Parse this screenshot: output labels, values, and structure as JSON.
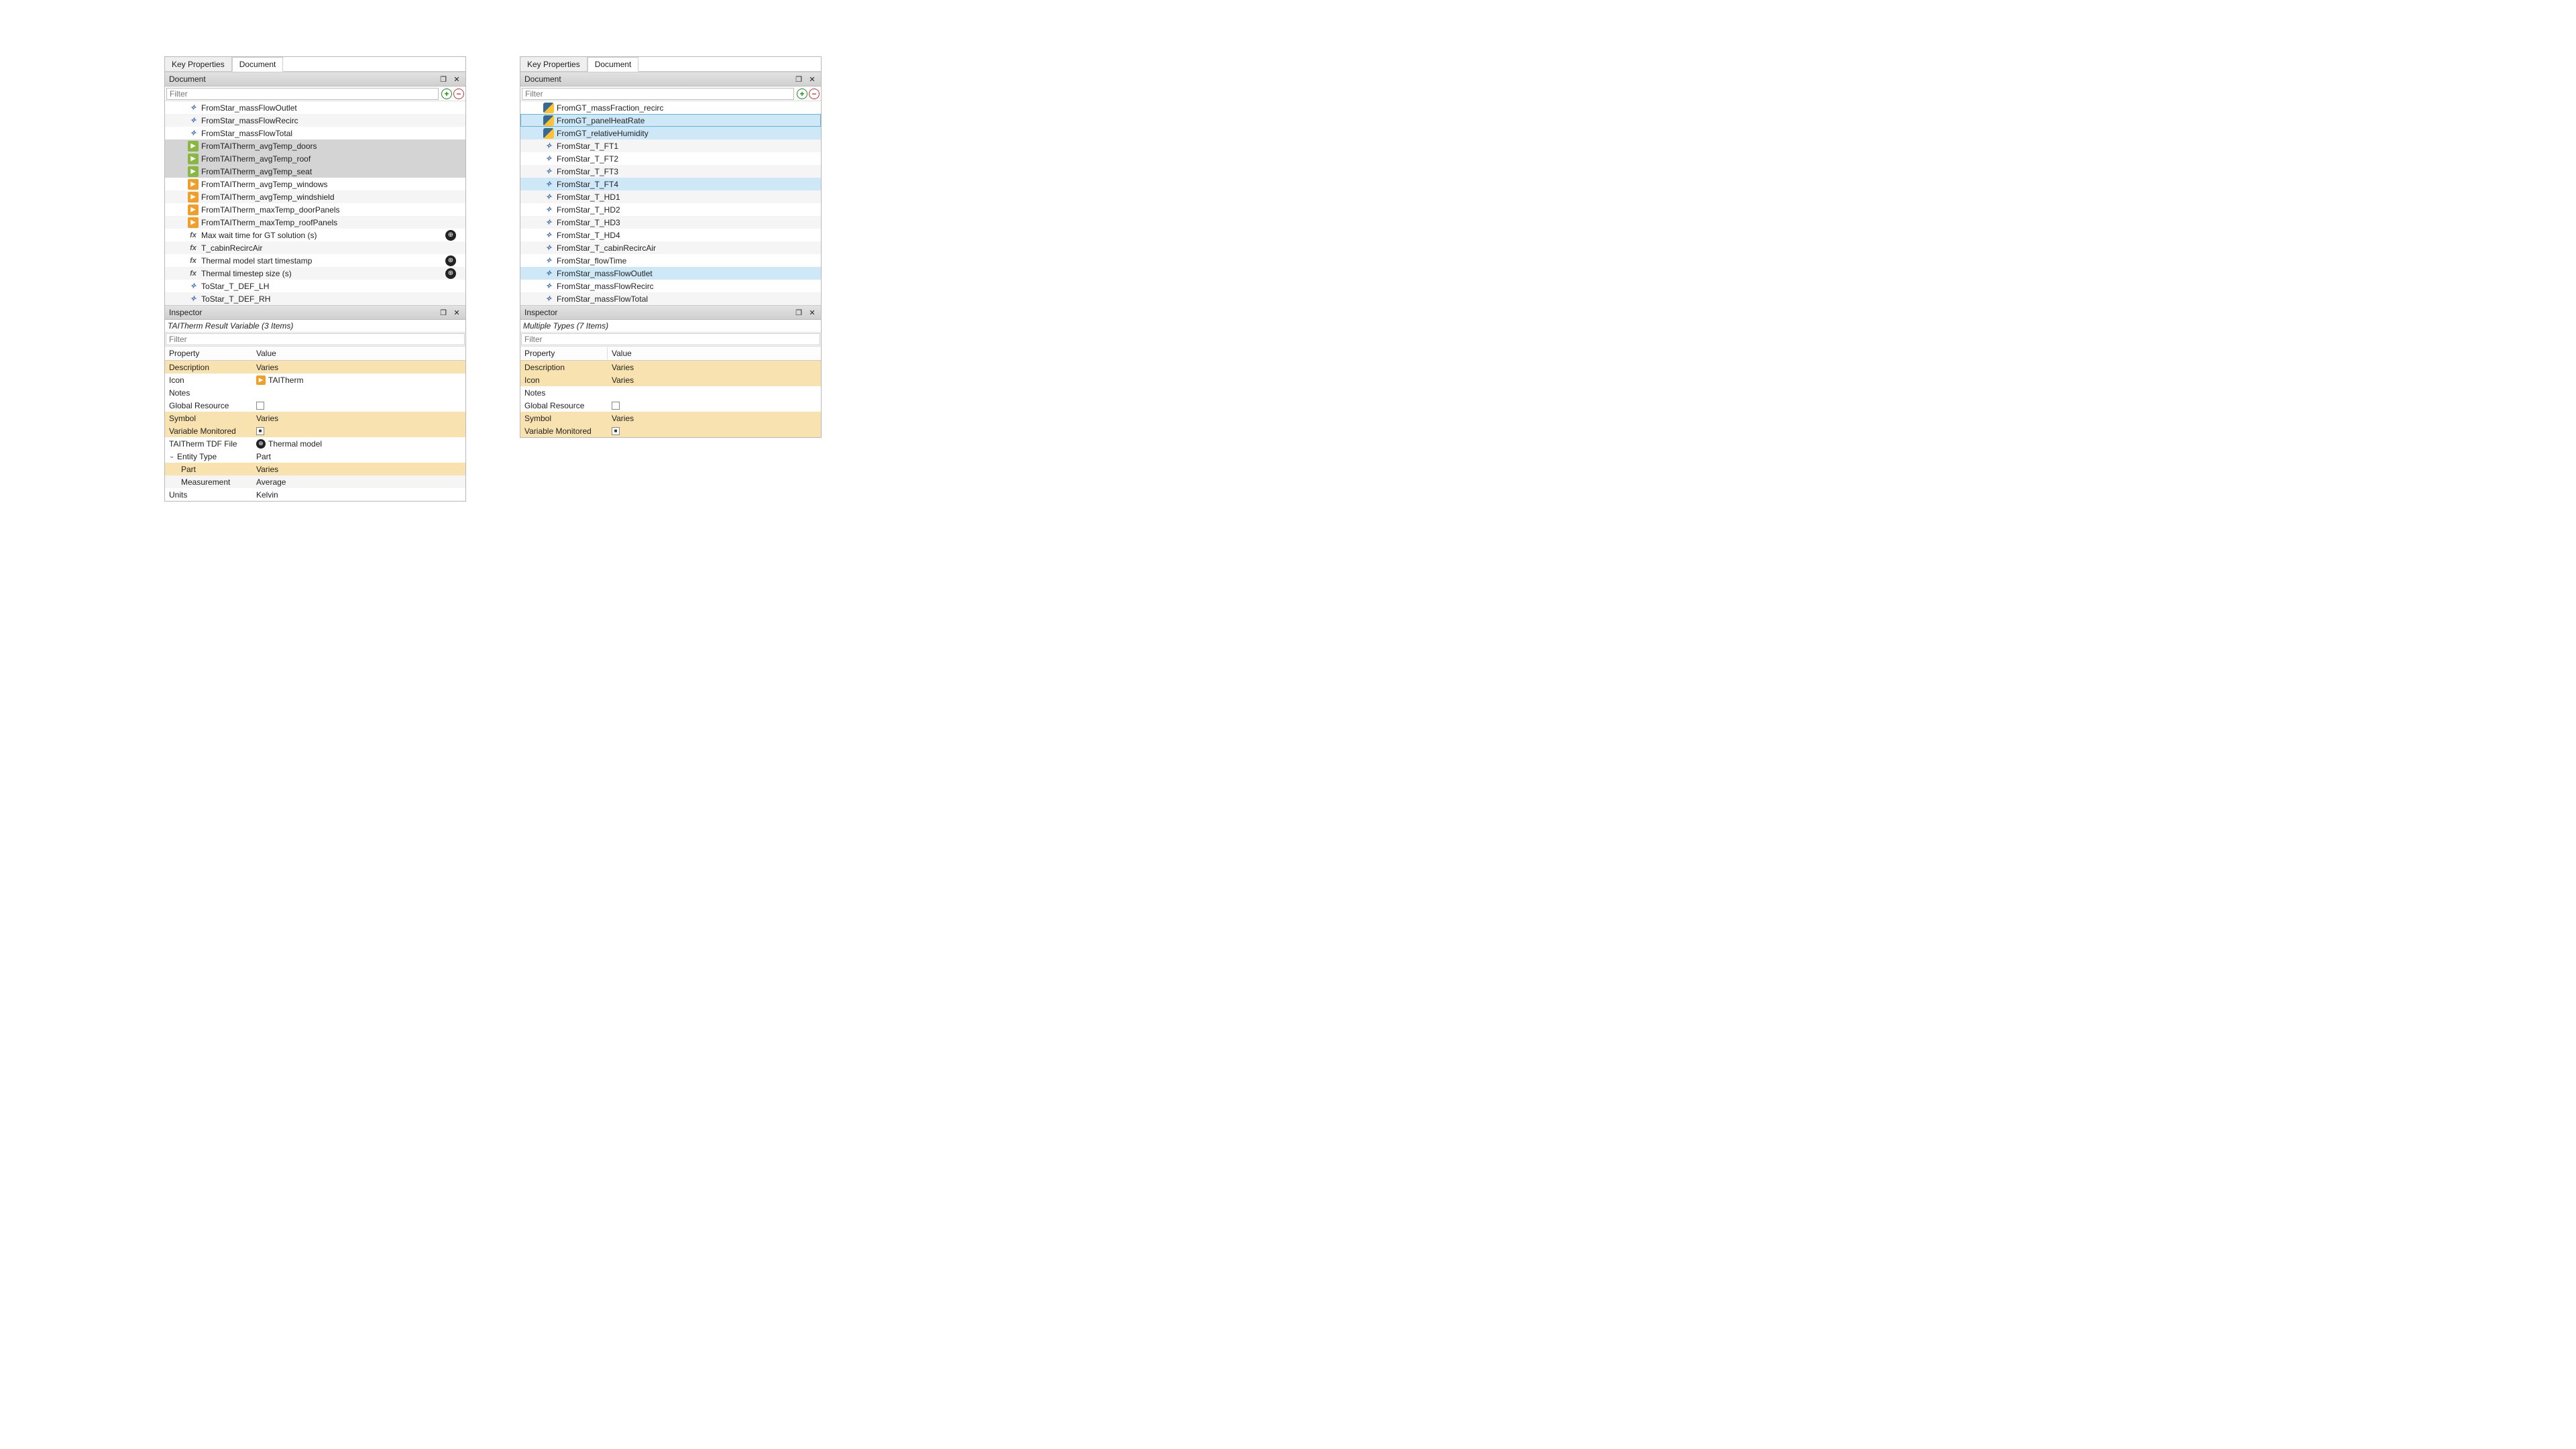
{
  "left": {
    "tabs": {
      "inactive": "Key Properties",
      "active": "Document"
    },
    "doc": {
      "title": "Document",
      "filter": "Filter",
      "items": [
        {
          "icon": "star",
          "label": "FromStar_massFlowOutlet"
        },
        {
          "icon": "star",
          "label": "FromStar_massFlowRecirc"
        },
        {
          "icon": "star",
          "label": "FromStar_massFlowTotal"
        },
        {
          "icon": "tai-g",
          "label": "FromTAITherm_avgTemp_doors",
          "sel": true
        },
        {
          "icon": "tai-g",
          "label": "FromTAITherm_avgTemp_roof",
          "sel": true
        },
        {
          "icon": "tai-g",
          "label": "FromTAITherm_avgTemp_seat",
          "sel": true
        },
        {
          "icon": "tai-y",
          "label": "FromTAITherm_avgTemp_windows"
        },
        {
          "icon": "tai-y",
          "label": "FromTAITherm_avgTemp_windshield"
        },
        {
          "icon": "tai-y",
          "label": "FromTAITherm_maxTemp_doorPanels"
        },
        {
          "icon": "tai-y",
          "label": "FromTAITherm_maxTemp_roofPanels"
        },
        {
          "icon": "fx",
          "label": "Max wait time for GT solution (s)",
          "globe": true
        },
        {
          "icon": "fx",
          "label": "T_cabinRecircAir"
        },
        {
          "icon": "fx",
          "label": "Thermal model start timestamp",
          "globe": true
        },
        {
          "icon": "fx",
          "label": "Thermal timestep size (s)",
          "globe": true
        },
        {
          "icon": "star",
          "label": "ToStar_T_DEF_LH"
        },
        {
          "icon": "star",
          "label": "ToStar_T_DEF_RH"
        }
      ]
    },
    "insp": {
      "title": "Inspector",
      "subtitle": "TAITherm Result Variable (3 Items)",
      "filter": "Filter",
      "hdr_property": "Property",
      "hdr_value": "Value",
      "rows": [
        {
          "k": "Description",
          "v": "Varies",
          "style": "y"
        },
        {
          "k": "Icon",
          "icon": "tai",
          "v": "TAITherm",
          "style": "w"
        },
        {
          "k": "Notes",
          "v": "",
          "style": "w"
        },
        {
          "k": "Global Resource",
          "chk": "empty",
          "style": "w"
        },
        {
          "k": "Symbol",
          "v": "Varies",
          "style": "y"
        },
        {
          "k": "Variable Monitored",
          "chk": "filled",
          "style": "y"
        },
        {
          "k": "TAITherm TDF File",
          "icon": "globe",
          "v": "Thermal model",
          "style": "w"
        },
        {
          "k": "Entity Type",
          "v": "Part",
          "style": "w",
          "expander": true
        },
        {
          "k": "Part",
          "v": "Varies",
          "style": "y",
          "indent": true
        },
        {
          "k": "Measurement",
          "v": "Average",
          "style": "g",
          "indent": true
        },
        {
          "k": "Units",
          "v": "Kelvin",
          "style": "w"
        }
      ]
    }
  },
  "right": {
    "tabs": {
      "inactive": "Key Properties",
      "active": "Document"
    },
    "doc": {
      "title": "Document",
      "filter": "Filter",
      "items": [
        {
          "icon": "py",
          "label": "FromGT_massFraction_recirc"
        },
        {
          "icon": "py",
          "label": "FromGT_panelHeatRate",
          "hi": true,
          "framed": true
        },
        {
          "icon": "py",
          "label": "FromGT_relativeHumidity",
          "hi": true
        },
        {
          "icon": "star",
          "label": "FromStar_T_FT1"
        },
        {
          "icon": "star",
          "label": "FromStar_T_FT2"
        },
        {
          "icon": "star",
          "label": "FromStar_T_FT3"
        },
        {
          "icon": "star",
          "label": "FromStar_T_FT4",
          "hi": true
        },
        {
          "icon": "star",
          "label": "FromStar_T_HD1"
        },
        {
          "icon": "star",
          "label": "FromStar_T_HD2"
        },
        {
          "icon": "star",
          "label": "FromStar_T_HD3"
        },
        {
          "icon": "star",
          "label": "FromStar_T_HD4"
        },
        {
          "icon": "star",
          "label": "FromStar_T_cabinRecircAir"
        },
        {
          "icon": "star",
          "label": "FromStar_flowTime"
        },
        {
          "icon": "star",
          "label": "FromStar_massFlowOutlet",
          "hi": true
        },
        {
          "icon": "star",
          "label": "FromStar_massFlowRecirc"
        },
        {
          "icon": "star",
          "label": "FromStar_massFlowTotal"
        }
      ]
    },
    "insp": {
      "title": "Inspector",
      "subtitle": "Multiple Types (7 Items)",
      "filter": "Filter",
      "hdr_property": "Property",
      "hdr_value": "Value",
      "rows": [
        {
          "k": "Description",
          "v": "Varies",
          "style": "y"
        },
        {
          "k": "Icon",
          "v": "Varies",
          "style": "y"
        },
        {
          "k": "Notes",
          "v": "",
          "style": "w"
        },
        {
          "k": "Global Resource",
          "chk": "empty",
          "style": "w"
        },
        {
          "k": "Symbol",
          "v": "Varies",
          "style": "y"
        },
        {
          "k": "Variable Monitored",
          "chk": "filled",
          "style": "y"
        }
      ]
    }
  }
}
